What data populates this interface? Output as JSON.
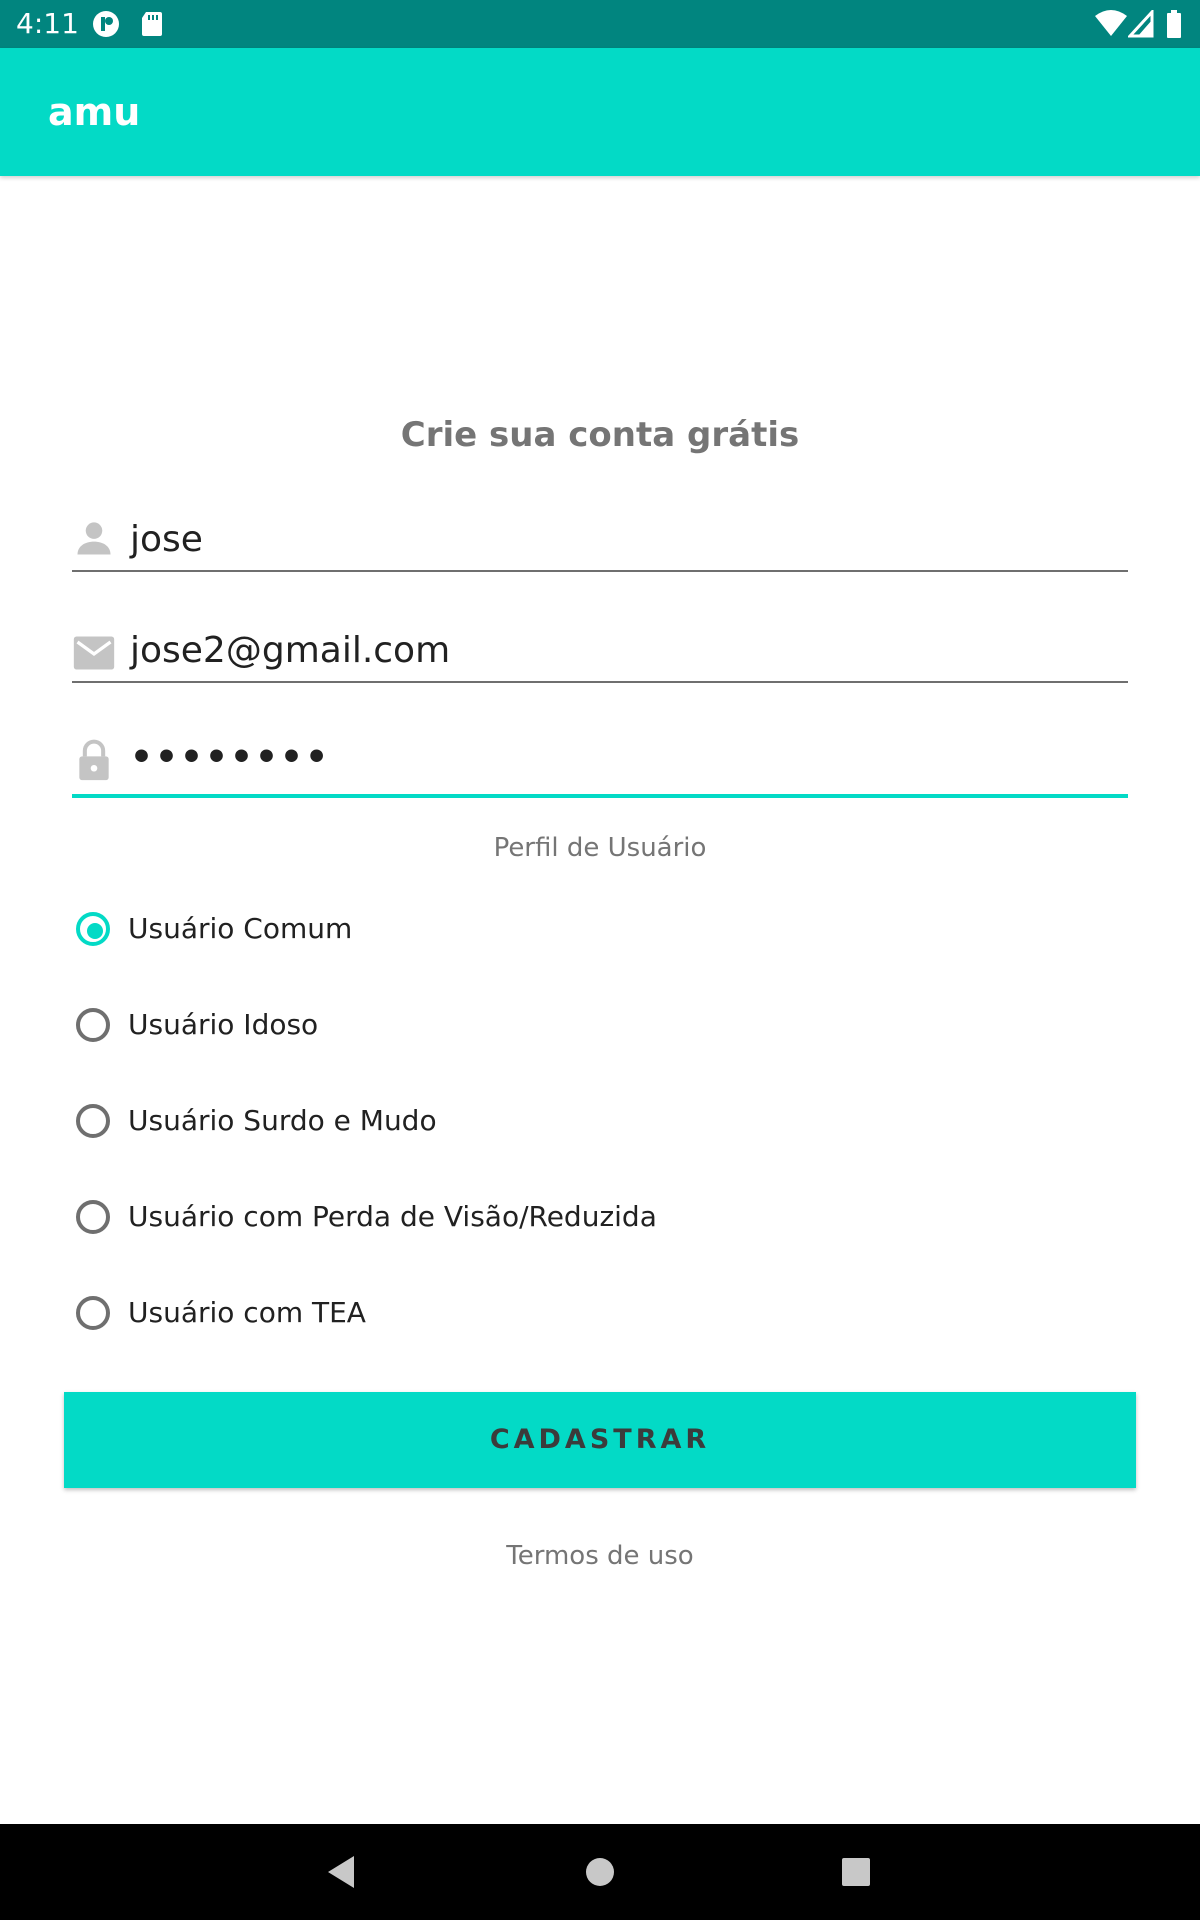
{
  "status_bar": {
    "time": "4:11",
    "left_icons": [
      "media-icon",
      "sd-card-icon"
    ],
    "right_icons": [
      "wifi-icon",
      "signal-icon",
      "battery-icon"
    ],
    "color": "#01857f"
  },
  "app_bar": {
    "title": "amu",
    "color": "#03dac6"
  },
  "form": {
    "headline": "Crie sua conta grátis",
    "name_field": {
      "icon": "person-icon",
      "value": "jose"
    },
    "email_field": {
      "icon": "email-icon",
      "value": "jose2@gmail.com"
    },
    "password_field": {
      "icon": "lock-icon",
      "value": "••••••••",
      "focused": true
    },
    "profile_label": "Perfil de Usuário",
    "profiles": [
      {
        "label": "Usuário Comum",
        "selected": true
      },
      {
        "label": "Usuário Idoso",
        "selected": false
      },
      {
        "label": "Usuário Surdo e Mudo",
        "selected": false
      },
      {
        "label": "Usuário com Perda de Visão/Reduzida",
        "selected": false
      },
      {
        "label": "Usuário com TEA",
        "selected": false
      }
    ],
    "submit_label": "CADASTRAR",
    "terms_label": "Termos de uso"
  },
  "nav_bar": {
    "buttons": [
      "back-icon",
      "home-icon",
      "recents-icon"
    ]
  }
}
